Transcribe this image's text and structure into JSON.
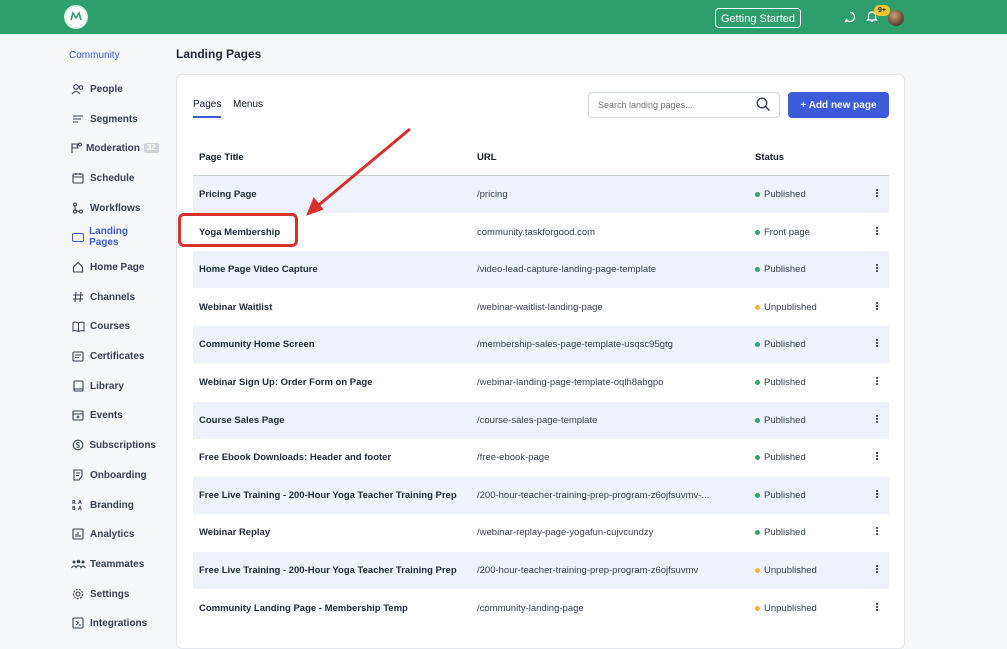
{
  "header": {
    "getting_started": "Getting Started",
    "notification_count": "9+"
  },
  "sidebar": {
    "heading": "Community",
    "items": [
      {
        "label": "People",
        "icon": "people-icon"
      },
      {
        "label": "Segments",
        "icon": "segments-icon"
      },
      {
        "label": "Moderation",
        "icon": "moderation-icon",
        "count": "32"
      },
      {
        "label": "Schedule",
        "icon": "calendar-icon"
      },
      {
        "label": "Workflows",
        "icon": "workflow-icon"
      },
      {
        "label": "Landing Pages",
        "icon": "landing-pages-icon",
        "active": true
      },
      {
        "label": "Home Page",
        "icon": "home-icon"
      },
      {
        "label": "Channels",
        "icon": "hashtag-icon"
      },
      {
        "label": "Courses",
        "icon": "book-icon"
      },
      {
        "label": "Certificates",
        "icon": "certificate-icon"
      },
      {
        "label": "Library",
        "icon": "library-icon"
      },
      {
        "label": "Events",
        "icon": "events-icon"
      },
      {
        "label": "Subscriptions",
        "icon": "subscriptions-icon"
      },
      {
        "label": "Onboarding",
        "icon": "onboarding-icon"
      },
      {
        "label": "Branding",
        "icon": "branding-icon"
      },
      {
        "label": "Analytics",
        "icon": "analytics-icon"
      },
      {
        "label": "Teammates",
        "icon": "teammates-icon"
      },
      {
        "label": "Settings",
        "icon": "gear-icon"
      },
      {
        "label": "Integrations",
        "icon": "integrations-icon"
      }
    ]
  },
  "main": {
    "title": "Landing Pages",
    "tabs": [
      "Pages",
      "Menus"
    ],
    "search_placeholder": "Search landing pages...",
    "add_button": "+ Add new page",
    "columns": {
      "title": "Page Title",
      "url": "URL",
      "status": "Status"
    },
    "rows": [
      {
        "title": "Pricing Page",
        "url": "/pricing",
        "status": "Published"
      },
      {
        "title": "Yoga Membership",
        "url": "community.taskforgood.com",
        "status": "Front page"
      },
      {
        "title": "Home Page Video Capture",
        "url": "/video-lead-capture-landing-page-template",
        "status": "Published"
      },
      {
        "title": "Webinar Waitlist",
        "url": "/webinar-waitlist-landing-page",
        "status": "Unpublished"
      },
      {
        "title": "Community Home Screen",
        "url": "/membership-sales-page-template-usqsc95gtg",
        "status": "Published"
      },
      {
        "title": "Webinar Sign Up: Order Form on Page",
        "url": "/webinar-landing-page-template-oqlh8abgpo",
        "status": "Published"
      },
      {
        "title": "Course Sales Page",
        "url": "/course-sales-page-template",
        "status": "Published"
      },
      {
        "title": "Free Ebook Downloads: Header and footer",
        "url": "/free-ebook-page",
        "status": "Published"
      },
      {
        "title": "Free Live Training - 200-Hour Yoga Teacher Training Prep",
        "url": "/200-hour-teacher-training-prep-program-z6ojfsuvmv-...",
        "status": "Published"
      },
      {
        "title": "Webinar Replay",
        "url": "/webinar-replay-page-yogafun-cujvcundzy",
        "status": "Published"
      },
      {
        "title": "Free Live Training - 200-Hour Yoga Teacher Training Prep",
        "url": "/200-hour-teacher-training-prep-program-z6ojfsuvmv",
        "status": "Unpublished"
      },
      {
        "title": "Community Landing Page - Membership Temp",
        "url": "/community-landing-page",
        "status": "Unpublished"
      }
    ]
  },
  "colors": {
    "brand_green": "#2e9e6c",
    "accent_blue": "#3b5bdb",
    "published": "#2fa66a",
    "unpublished": "#f2b632",
    "annotation": "#d9302c"
  }
}
